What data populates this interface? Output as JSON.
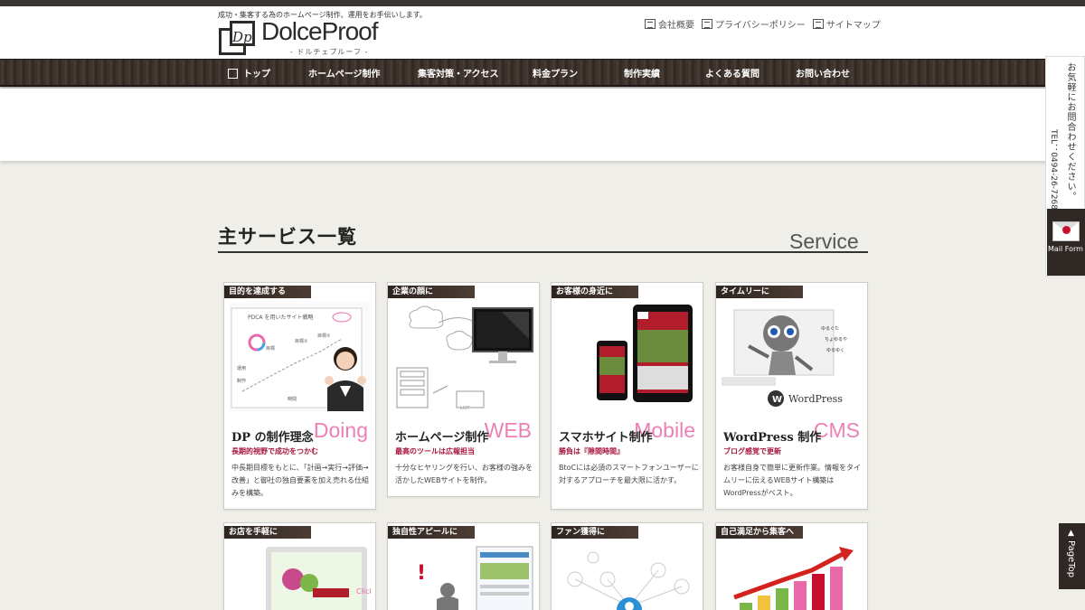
{
  "header": {
    "tagline": "成功・集客する為のホームページ制作、運用をお手伝いします。",
    "logo_name": "DolceProof",
    "logo_kana": "- ドルチェプルーフ -",
    "links": [
      "会社概要",
      "プライバシーポリシー",
      "サイトマップ"
    ]
  },
  "nav": {
    "items": [
      "トップ",
      "ホームページ制作",
      "集客対策・アクセス",
      "料金プラン",
      "制作実績",
      "よくある質問",
      "お問い合わせ"
    ]
  },
  "section": {
    "title": "主サービス一覧",
    "en": "Service"
  },
  "cards": [
    {
      "tag": "目的を達成する",
      "title": "DP の制作理念",
      "en": "Doing",
      "sub": "長期的視野で成功をつかむ",
      "desc": "中長期目標をもとに、「計画→実行→評価→改善」と御社の独自要素を加え売れる仕組みを構築。",
      "img_text": [
        "PDCA を用いたサイト戦略",
        "目標",
        "目標①",
        "目標②",
        "運用",
        "制作",
        "時間"
      ]
    },
    {
      "tag": "企業の顔に",
      "title": "ホームページ制作",
      "en": "WEB",
      "sub": "最高のツールは広報担当",
      "desc": "十分なヒヤリングを行い、お客様の強みを活かしたWEBサイトを制作。",
      "img_text": [
        "LIST"
      ]
    },
    {
      "tag": "お客様の身近に",
      "title": "スマホサイト制作",
      "en": "Mobile",
      "sub": "勝負は『隙間時間』",
      "desc": "BtoCには必須のスマートフォンユーザーに対するアプローチを最大限に活かす。",
      "img_text": []
    },
    {
      "tag": "タイムリーに",
      "title": "WordPress 制作",
      "en": "CMS",
      "sub": "ブログ感覚で更新",
      "desc": "お客様自身で簡単に更新作業。情報をタイムリーに伝えるWEBサイト構築はWordPressがベスト。",
      "img_text": [
        "WordPress"
      ]
    },
    {
      "tag": "お店を手軽に",
      "img_text": [
        "Click"
      ]
    },
    {
      "tag": "独自性アピールに",
      "img_text": []
    },
    {
      "tag": "ファン獲得に",
      "img_text": []
    },
    {
      "tag": "自己満足から集客へ",
      "img_text": []
    }
  ],
  "side": {
    "contact": "お気軽にお問合わせください。",
    "tel": "TEL：0494-26-7268",
    "mail": "Mail Form",
    "pagetop": "PageTop"
  },
  "colors": {
    "accent_pink": "#e96aa8",
    "subtitle_red": "#a8143b",
    "dark_brown": "#2f2824",
    "background": "#efeee9"
  }
}
